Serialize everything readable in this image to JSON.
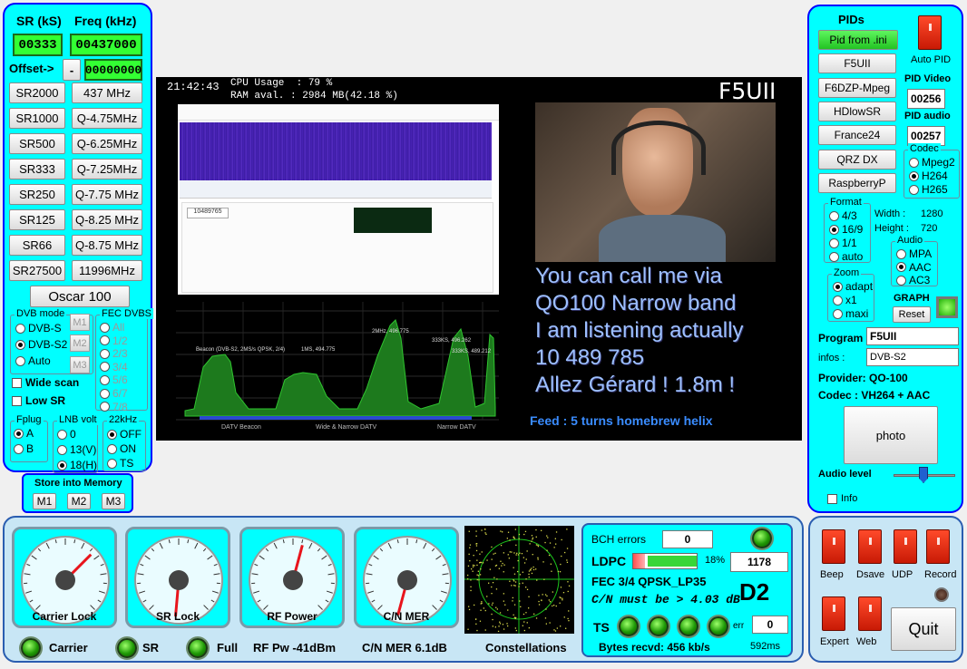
{
  "left": {
    "sr_label": "SR (kS)",
    "freq_label": "Freq (kHz)",
    "sr_value": "00333",
    "freq_value": "00437000",
    "offset_label": "Offset->",
    "offset_sign": "-",
    "offset_value": "00000000",
    "sr_buttons": [
      "SR2000",
      "SR1000",
      "SR500",
      "SR333",
      "SR250",
      "SR125",
      "SR66",
      "SR27500"
    ],
    "freq_buttons": [
      "437 MHz",
      "Q-4.75MHz",
      "Q-6.25MHz",
      "Q-7.25MHz",
      "Q-7.75 MHz",
      "Q-8.25 MHz",
      "Q-8.75 MHz",
      "11996MHz"
    ],
    "oscar_button": "Oscar 100",
    "dvb_mode_title": "DVB mode",
    "dvb_modes": [
      "DVB-S",
      "DVB-S2",
      "Auto"
    ],
    "dvb_selected": "DVB-S2",
    "m_buttons": [
      "M1",
      "M2",
      "M3"
    ],
    "fec_title": "FEC DVBS",
    "fec_options": [
      "All",
      "1/2",
      "2/3",
      "3/4",
      "5/6",
      "6/7",
      "7/8"
    ],
    "wide_scan": "Wide scan",
    "low_sr": "Low SR",
    "fplug_title": "Fplug",
    "fplug_options": [
      "A",
      "B"
    ],
    "fplug_selected": "A",
    "lnb_title": "LNB volt",
    "lnb_options": [
      "0",
      "13(V)",
      "18(H)"
    ],
    "lnb_selected": "18(H)",
    "khz_title": "22kHz",
    "khz_options": [
      "OFF",
      "ON",
      "TS"
    ],
    "khz_selected": "OFF",
    "store_title": "Store into Memory",
    "store_buttons": [
      "M1",
      "M2",
      "M3"
    ]
  },
  "video": {
    "time": "21:42:43",
    "cpu": "CPU Usage  : 79 %",
    "ram": "RAM aval. : 2984 MB(42.18 %)",
    "callsign": "F5UII",
    "overlay_lines": [
      "You can call me via",
      "QO100 Narrow band",
      "I am listening actually",
      "10 489 785",
      "Allez Gérard ! 1.8m !"
    ],
    "feed": "Feed : 5 turns homebrew helix",
    "sdr_freq": "10489765",
    "spectrum_labels": [
      "Beacon (DVB-S2, 2MS/s QPSK, 2/4)",
      "1MS, 494.775",
      "2MHz, 496.775",
      "333KS, 496.262",
      "333KS, 489.212"
    ],
    "band_labels": [
      "DATV Beacon",
      "Wide & Narrow DATV",
      "Narrow DATV"
    ]
  },
  "right": {
    "pids_title": "PIDs",
    "pid_buttons": [
      "Pid from .ini",
      "F5UII",
      "F6DZP-Mpeg",
      "HDlowSR",
      "France24",
      "QRZ DX",
      "RaspberryP"
    ],
    "auto_pid": "Auto PID",
    "pid_video_label": "PID Video",
    "pid_video": "00256",
    "pid_audio_label": "PID audio",
    "pid_audio": "00257",
    "codec_title": "Codec",
    "codec_options": [
      "Mpeg2",
      "H264",
      "H265"
    ],
    "codec_selected": "H264",
    "format_title": "Format",
    "format_options": [
      "4/3",
      "16/9",
      "1/1",
      "auto"
    ],
    "format_selected": "16/9",
    "width_label": "Width :",
    "width": "1280",
    "height_label": "Height :",
    "height": "720",
    "audio_title": "Audio",
    "audio_options": [
      "MPA",
      "AAC",
      "AC3"
    ],
    "audio_selected": "AAC",
    "zoom_title": "Zoom",
    "zoom_options": [
      "adapt",
      "x1",
      "maxi"
    ],
    "zoom_selected": "adapt",
    "graph_label": "GRAPH",
    "reset": "Reset",
    "program_label": "Program",
    "program": "F5UII",
    "infos_label": "infos :",
    "infos": "DVB-S2",
    "provider": "Provider: QO-100",
    "codec_line": "Codec :   VH264 + AAC",
    "photo": "photo",
    "audio_level": "Audio level",
    "info": "Info"
  },
  "bottom": {
    "gauges": [
      "Carrier Lock",
      "SR Lock",
      "RF Power",
      "C/N MER"
    ],
    "status": [
      "Carrier",
      "SR",
      "Full"
    ],
    "rf_pw": "RF Pw -41dBm",
    "cn_mer": "C/N MER 6.1dB",
    "constellations": "Constellations",
    "bch_label": "BCH errors",
    "bch": "0",
    "ldpc_label": "LDPC",
    "ldpc_pct": "18%",
    "ldpc_value": "1178",
    "ldpc_fill": 0.18,
    "fec": "FEC  3/4 QPSK_LP35",
    "cn_must": "C/N must be > 4.03 dB",
    "d2": "D2",
    "ts_label": "TS",
    "err_label": "err",
    "ts_err": "0",
    "bytes": "Bytes recvd:  456 kb/s",
    "ms": "592ms"
  },
  "controls": {
    "switches": [
      "Beep",
      "Dsave",
      "UDP",
      "Record",
      "Expert",
      "Web"
    ],
    "quit": "Quit"
  }
}
